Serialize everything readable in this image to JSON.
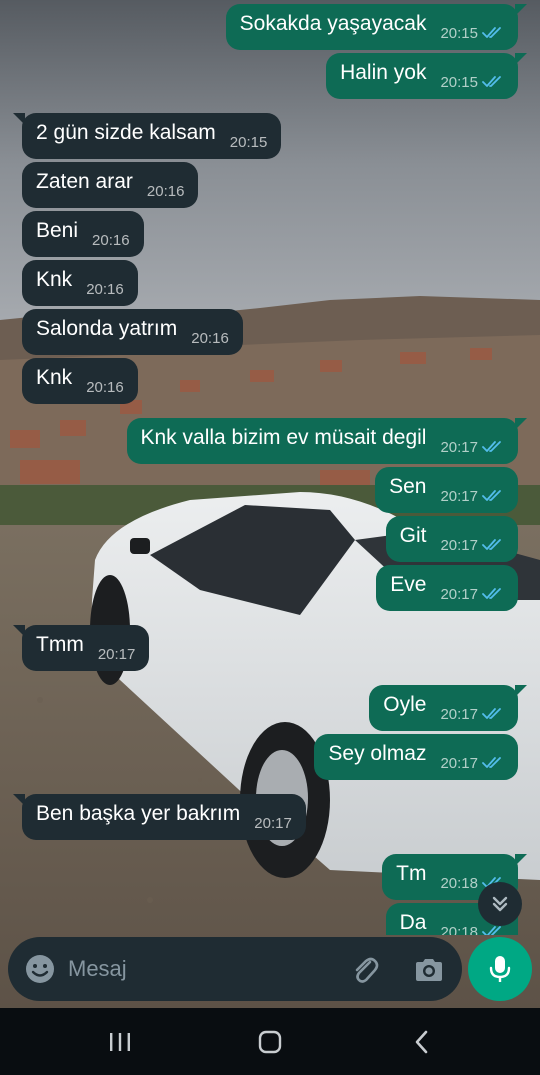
{
  "messages": [
    {
      "text": "Sokakda yaşayacak",
      "time": "20:15",
      "dir": "out",
      "read": true
    },
    {
      "text": "Halin yok",
      "time": "20:15",
      "dir": "out",
      "read": true
    },
    {
      "text": "2 gün sizde kalsam",
      "time": "20:15",
      "dir": "in"
    },
    {
      "text": "Zaten arar",
      "time": "20:16",
      "dir": "in"
    },
    {
      "text": "Beni",
      "time": "20:16",
      "dir": "in"
    },
    {
      "text": "Knk",
      "time": "20:16",
      "dir": "in"
    },
    {
      "text": "Salonda yatrım",
      "time": "20:16",
      "dir": "in"
    },
    {
      "text": "Knk",
      "time": "20:16",
      "dir": "in"
    },
    {
      "text": "Knk valla bizim ev müsait degil",
      "time": "20:17",
      "dir": "out",
      "read": true
    },
    {
      "text": "Sen",
      "time": "20:17",
      "dir": "out",
      "read": true
    },
    {
      "text": "Git",
      "time": "20:17",
      "dir": "out",
      "read": true
    },
    {
      "text": "Eve",
      "time": "20:17",
      "dir": "out",
      "read": true
    },
    {
      "text": "Tmm",
      "time": "20:17",
      "dir": "in"
    },
    {
      "text": "Oyle",
      "time": "20:17",
      "dir": "out",
      "read": true
    },
    {
      "text": "Sey olmaz",
      "time": "20:17",
      "dir": "out",
      "read": true
    },
    {
      "text": "Ben başka yer bakrım",
      "time": "20:17",
      "dir": "in"
    },
    {
      "text": "Tm",
      "time": "20:18",
      "dir": "out",
      "read": true
    },
    {
      "text": "Da",
      "time": "20:18",
      "dir": "out",
      "read": true
    }
  ],
  "composer": {
    "placeholder": "Mesaj",
    "emoji_icon": "emoji-icon",
    "attach_icon": "paperclip-icon",
    "camera_icon": "camera-icon",
    "mic_icon": "microphone-icon"
  },
  "scroll_down_icon": "double-chevron-down-icon",
  "navbar": {
    "recent_icon": "recent-apps-icon",
    "home_icon": "home-icon",
    "back_icon": "back-icon"
  },
  "colors": {
    "outgoing_bubble": "#0e6b55",
    "incoming_bubble": "#1f2c33",
    "read_ticks": "#53bdeb",
    "mic_button": "#00a884",
    "navbar": "#090d11"
  }
}
